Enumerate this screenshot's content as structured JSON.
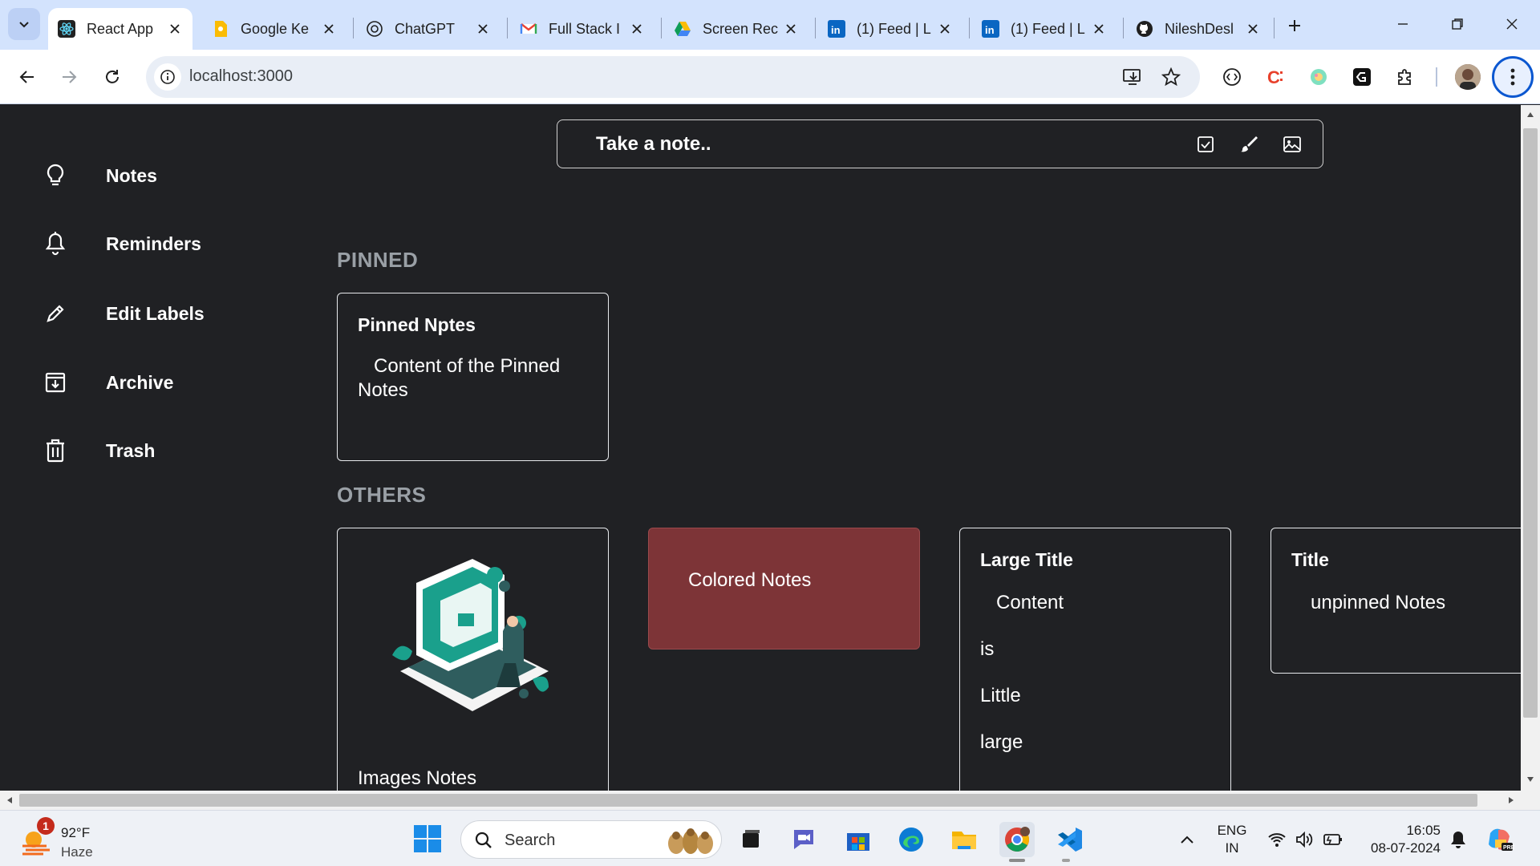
{
  "browser": {
    "tabs": [
      {
        "title": "React App",
        "icon": "react-favicon",
        "active": true
      },
      {
        "title": "Google Ke",
        "icon": "google-keep-favicon",
        "active": false
      },
      {
        "title": "ChatGPT",
        "icon": "chatgpt-favicon",
        "active": false
      },
      {
        "title": "Full Stack I",
        "icon": "gmail-favicon",
        "active": false
      },
      {
        "title": "Screen Rec",
        "icon": "google-drive-favicon",
        "active": false
      },
      {
        "title": "(1) Feed | L",
        "icon": "linkedin-favicon",
        "active": false
      },
      {
        "title": "(1) Feed | L",
        "icon": "linkedin-favicon",
        "active": false
      },
      {
        "title": "NileshDesl",
        "icon": "github-favicon",
        "active": false
      }
    ],
    "url": "localhost:3000",
    "colors": {
      "tabstrip": "#d3e3fd",
      "toolbar": "#ffffff",
      "accent": "#0b57d0"
    }
  },
  "sidebar": {
    "items": [
      {
        "label": "Notes",
        "icon": "lightbulb-icon"
      },
      {
        "label": "Reminders",
        "icon": "bell-icon"
      },
      {
        "label": "Edit Labels",
        "icon": "pencil-icon"
      },
      {
        "label": "Archive",
        "icon": "archive-icon"
      },
      {
        "label": "Trash",
        "icon": "trash-icon"
      }
    ]
  },
  "note_input": {
    "placeholder": "Take a note..",
    "tools": [
      "checkbox-icon",
      "brush-icon",
      "image-icon"
    ]
  },
  "sections": {
    "pinned": "PINNED",
    "others": "OTHERS"
  },
  "pinned_notes": [
    {
      "title": "Pinned Nptes",
      "content": "   Content of the Pinned Notes"
    }
  ],
  "other_notes": [
    {
      "title": "",
      "content": "Images Notes",
      "has_image": true
    },
    {
      "title": "",
      "content": "Colored Notes",
      "background": "#7d3437"
    },
    {
      "title": "Large Title",
      "content_lines": [
        "   Content",
        "is",
        "Little",
        "large"
      ]
    },
    {
      "title": "Title",
      "content": "unpinned Notes"
    }
  ],
  "page_colors": {
    "background": "#202124",
    "card_border": "#e8eaed",
    "section_label": "#9aa0a6"
  },
  "taskbar": {
    "weather": {
      "temp": "92°F",
      "desc": "Haze",
      "badge": "1"
    },
    "search_placeholder": "Search",
    "apps": [
      "windows-start-icon",
      "file-explorer-icon",
      "teams-icon",
      "store-icon",
      "edge-icon",
      "folder-icon",
      "chrome-icon",
      "vscode-icon"
    ],
    "language": {
      "line1": "ENG",
      "line2": "IN"
    },
    "time": "16:05",
    "date": "08-07-2024"
  }
}
